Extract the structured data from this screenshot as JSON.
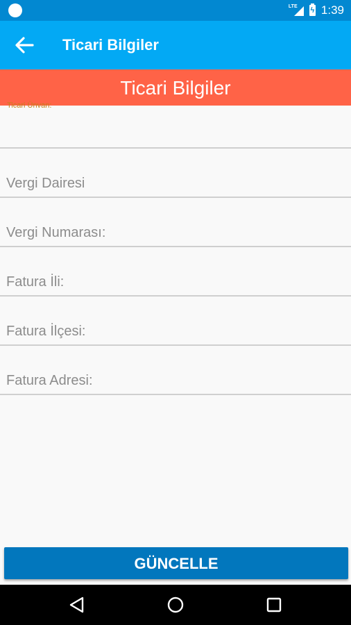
{
  "status_bar": {
    "network_label": "LTE",
    "time": "1:39",
    "icons": [
      "notification-dot-icon",
      "lte-signal-icon",
      "battery-charging-icon"
    ]
  },
  "app_bar": {
    "back_icon": "arrow-left-icon",
    "title": "Ticari Bilgiler",
    "color": "#03a9f4"
  },
  "section": {
    "title": "Ticari Bilgiler",
    "color": "#ff6347"
  },
  "form": {
    "ticari_unvan": {
      "label": "Ticari Ünvan:",
      "value": ""
    },
    "vergi_dairesi": {
      "placeholder": "Vergi Dairesi"
    },
    "vergi_numarasi": {
      "placeholder": "Vergi Numarası:"
    },
    "fatura_ili": {
      "placeholder": "Fatura İli:"
    },
    "fatura_ilcesi": {
      "placeholder": "Fatura İlçesi:"
    },
    "fatura_adresi": {
      "placeholder": "Fatura Adresi:"
    }
  },
  "actions": {
    "update_label": "GÜNCELLE",
    "color": "#0277bd"
  },
  "nav": {
    "icons": [
      "back-triangle-icon",
      "home-circle-icon",
      "recents-square-icon"
    ]
  }
}
